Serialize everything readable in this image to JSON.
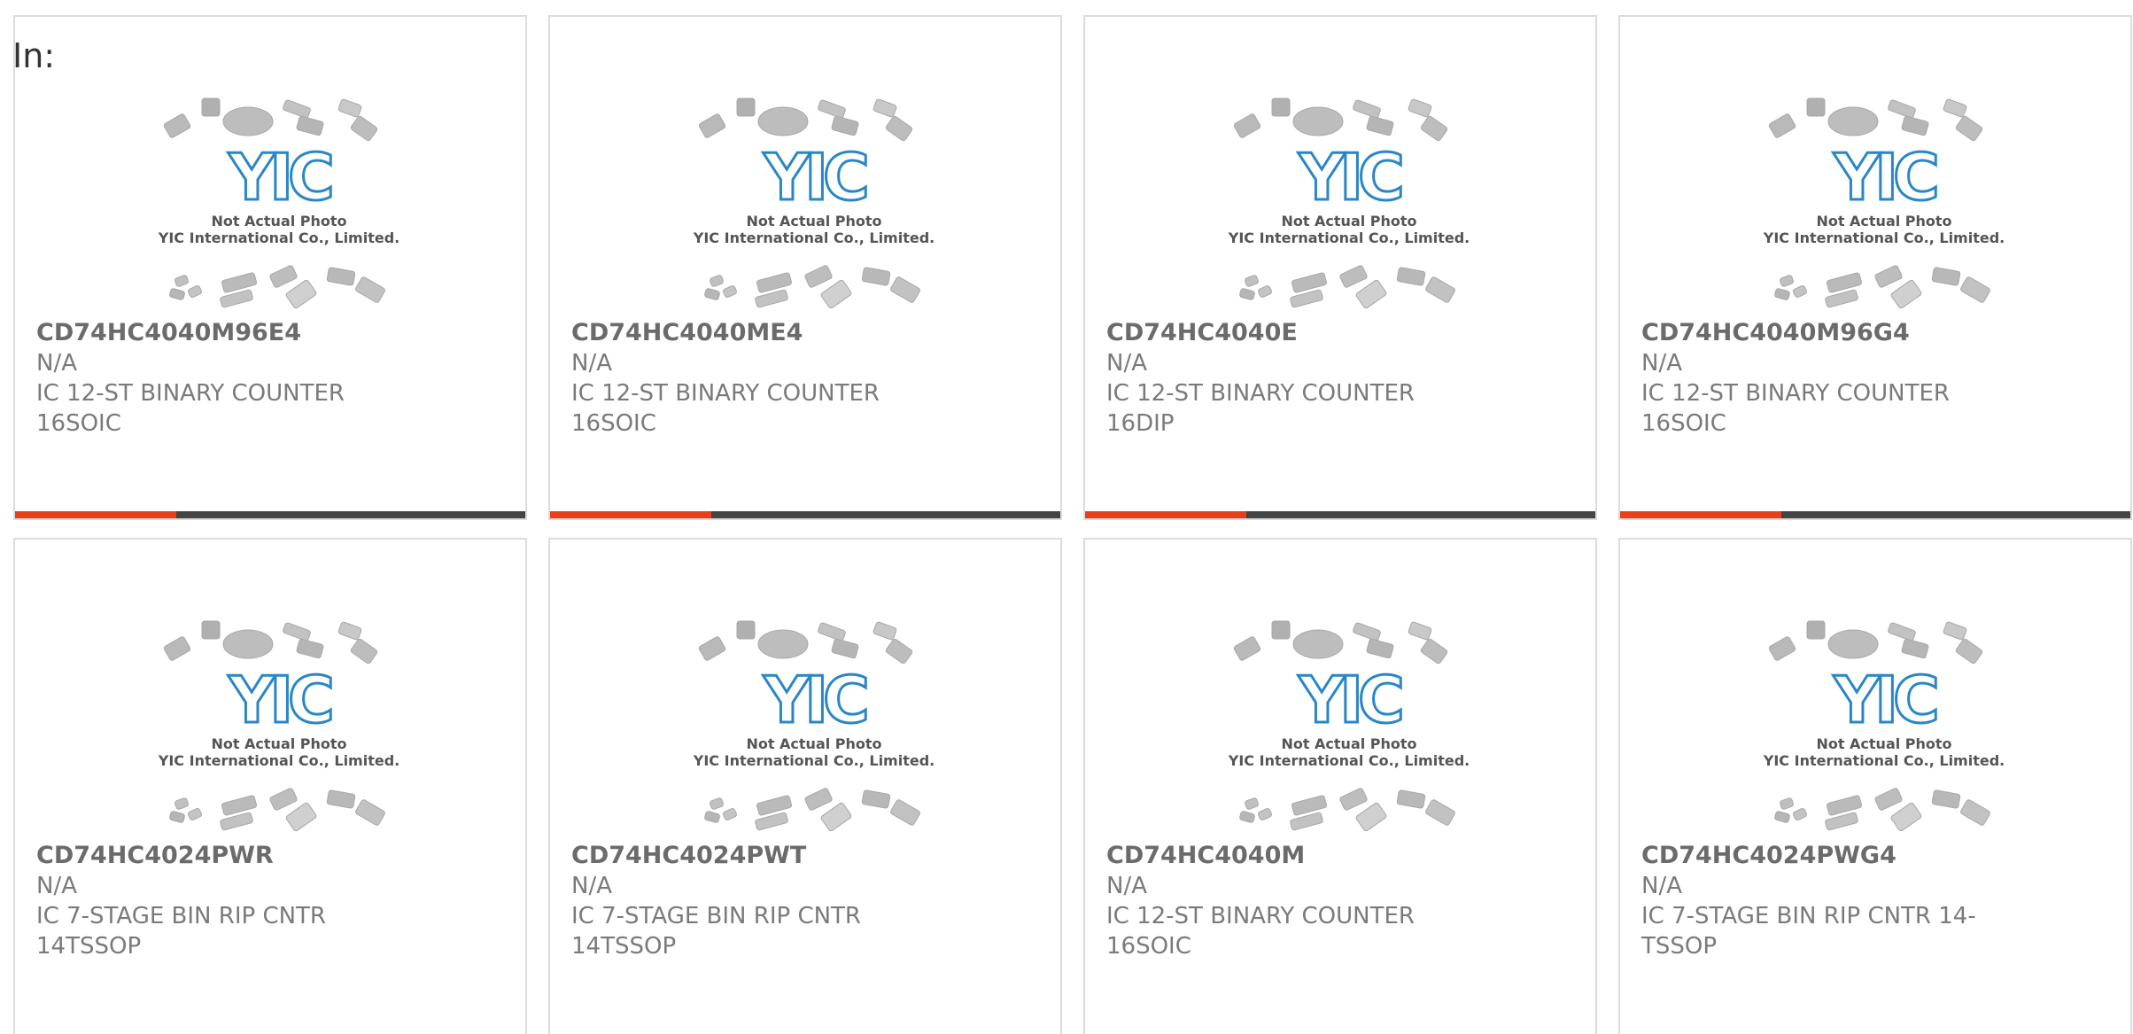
{
  "heading": "In:",
  "colors": {
    "accent_bar": "#e8401c",
    "dark_bar": "#444444",
    "logo_blue": "#2a86c6"
  },
  "placeholder": {
    "logo_text": "YIC",
    "line1": "Not Actual Photo",
    "line2": "YIC International Co., Limited.",
    "icon": "ic-chip-placeholder-icon"
  },
  "products": [
    {
      "part": "CD74HC4040M96E4",
      "mfr": "N/A",
      "desc": "IC 12-ST BINARY COUNTER 16SOIC"
    },
    {
      "part": "CD74HC4040ME4",
      "mfr": "N/A",
      "desc": "IC 12-ST BINARY COUNTER 16SOIC"
    },
    {
      "part": "CD74HC4040E",
      "mfr": "N/A",
      "desc": "IC 12-ST BINARY COUNTER 16DIP"
    },
    {
      "part": "CD74HC4040M96G4",
      "mfr": "N/A",
      "desc": "IC 12-ST BINARY COUNTER 16SOIC"
    },
    {
      "part": "CD74HC4024PWR",
      "mfr": "N/A",
      "desc": "IC 7-STAGE BIN RIP CNTR 14TSSOP"
    },
    {
      "part": "CD74HC4024PWT",
      "mfr": "N/A",
      "desc": "IC 7-STAGE BIN RIP CNTR 14TSSOP"
    },
    {
      "part": "CD74HC4040M",
      "mfr": "N/A",
      "desc": "IC 12-ST BINARY COUNTER 16SOIC"
    },
    {
      "part": "CD74HC4024PWG4",
      "mfr": "N/A",
      "desc": "IC 7-STAGE BIN RIP CNTR 14-TSSOP"
    }
  ]
}
